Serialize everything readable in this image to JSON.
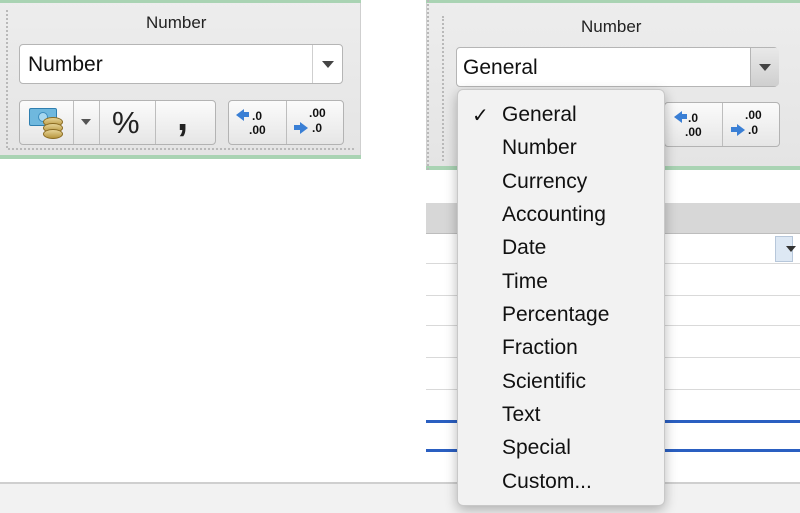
{
  "left_panel": {
    "group_title": "Number",
    "format_select": {
      "value": "Number"
    },
    "buttons": {
      "percent_label": "%",
      "comma_label": ",",
      "decrease_decimal_top": ".0",
      "decrease_decimal_bottom": ".00",
      "increase_decimal_top": ".00",
      "increase_decimal_bottom": ".0"
    }
  },
  "right_panel": {
    "group_title": "Number",
    "format_select": {
      "value": "General"
    },
    "buttons": {
      "decrease_decimal_top": ".0",
      "decrease_decimal_bottom": ".00",
      "increase_decimal_top": ".00",
      "increase_decimal_bottom": ".0"
    },
    "dropdown_menu": {
      "checkmark": "✓",
      "selected": "General",
      "items": [
        "General",
        "Number",
        "Currency",
        "Accounting",
        "Date",
        "Time",
        "Percentage",
        "Fraction",
        "Scientific",
        "Text",
        "Special",
        "Custom..."
      ]
    }
  },
  "colors": {
    "ribbon_accent": "#a9d3b3",
    "arrow_blue": "#3a7fd5",
    "selection_line": "#2a5fc1"
  }
}
